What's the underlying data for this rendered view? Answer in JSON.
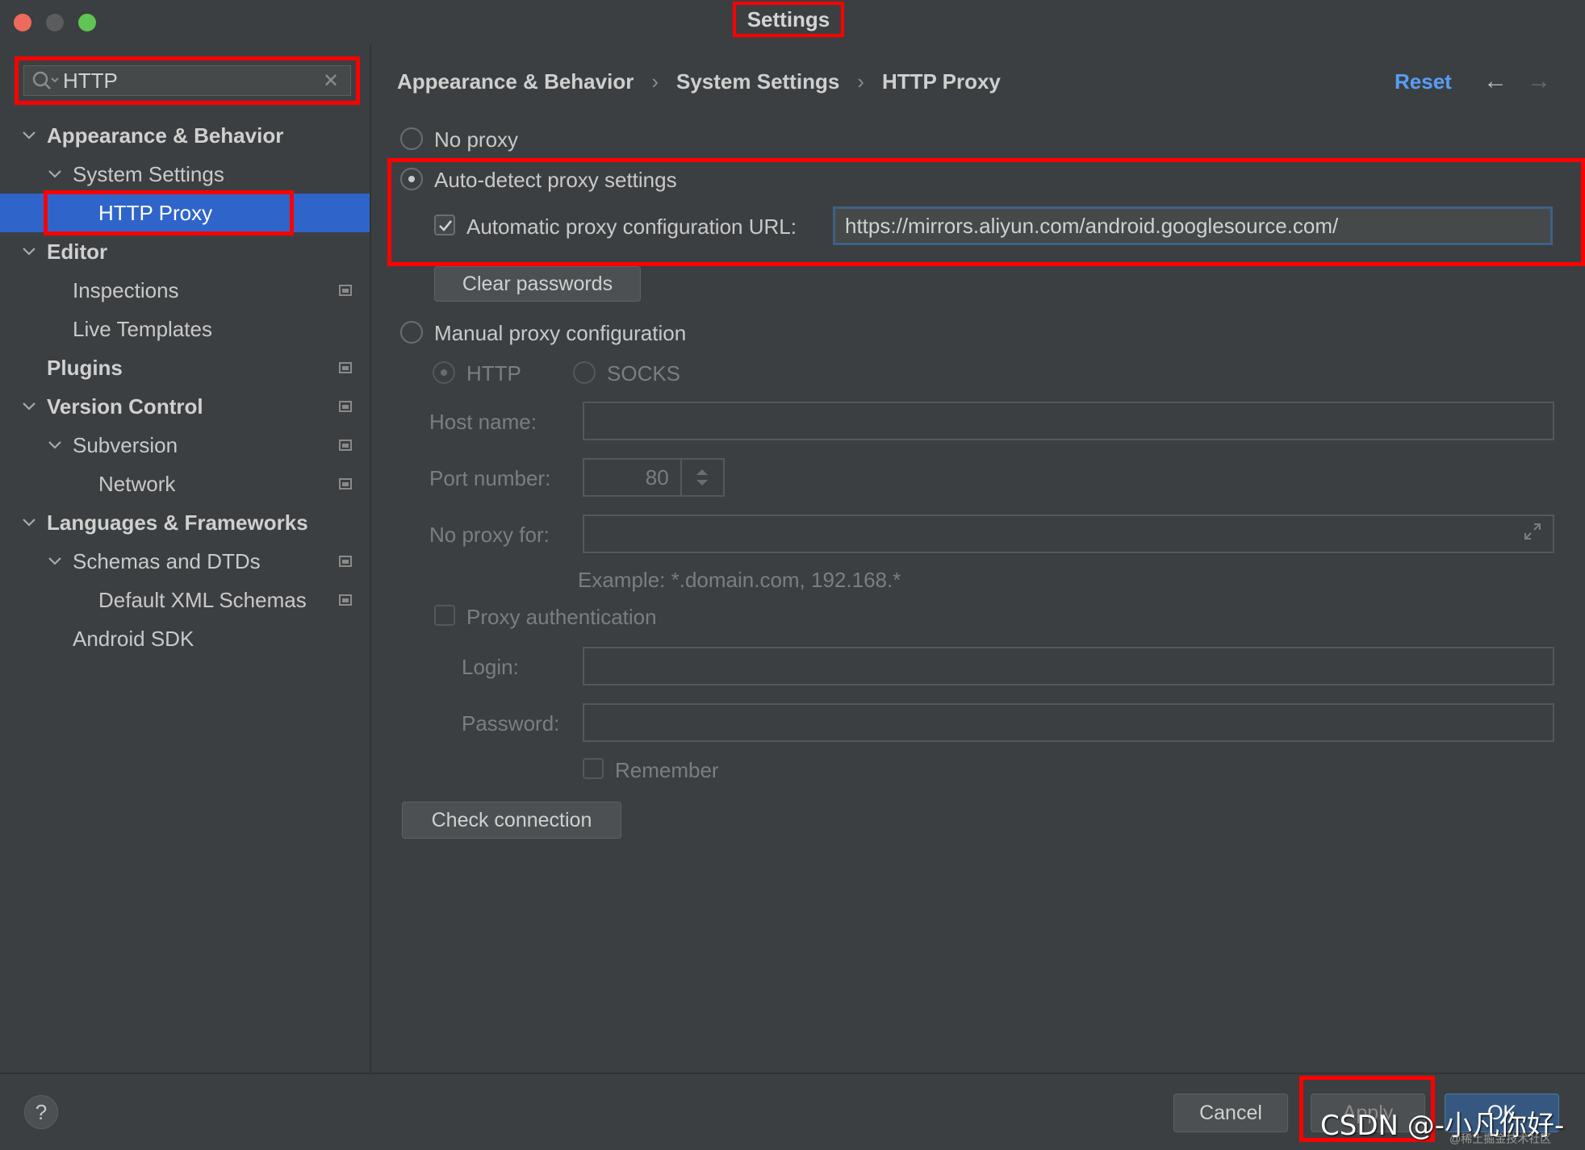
{
  "window": {
    "title": "Settings"
  },
  "search": {
    "value": "HTTP",
    "clear_icon": "close-icon"
  },
  "tree": {
    "appearance": "Appearance & Behavior",
    "system_settings": "System Settings",
    "http_proxy": "HTTP Proxy",
    "editor": "Editor",
    "inspections": "Inspections",
    "live_templates": "Live Templates",
    "plugins": "Plugins",
    "version_control": "Version Control",
    "subversion": "Subversion",
    "network": "Network",
    "languages": "Languages & Frameworks",
    "schemas": "Schemas and DTDs",
    "default_xml": "Default XML Schemas",
    "android_sdk": "Android SDK"
  },
  "breadcrumb": {
    "part1": "Appearance & Behavior",
    "part2": "System Settings",
    "part3": "HTTP Proxy",
    "separator": "›"
  },
  "header": {
    "reset": "Reset",
    "back": "←",
    "forward": "→"
  },
  "proxy": {
    "no_proxy": "No proxy",
    "auto_detect": "Auto-detect proxy settings",
    "auto_config_url_label": "Automatic proxy configuration URL:",
    "auto_config_url_value": "https://mirrors.aliyun.com/android.googlesource.com/",
    "clear_passwords": "Clear passwords",
    "manual": "Manual proxy configuration",
    "http": "HTTP",
    "socks": "SOCKS",
    "host_label": "Host name:",
    "port_label": "Port number:",
    "port_value": "80",
    "no_proxy_for_label": "No proxy for:",
    "example": "Example: *.domain.com, 192.168.*",
    "proxy_auth": "Proxy authentication",
    "login_label": "Login:",
    "password_label": "Password:",
    "remember": "Remember",
    "check_connection": "Check connection"
  },
  "footer": {
    "help": "?",
    "cancel": "Cancel",
    "apply": "Apply",
    "ok": "OK",
    "watermark": "CSDN @-小凡你好-",
    "watermark_small": "@稀土掘金技术社区"
  }
}
